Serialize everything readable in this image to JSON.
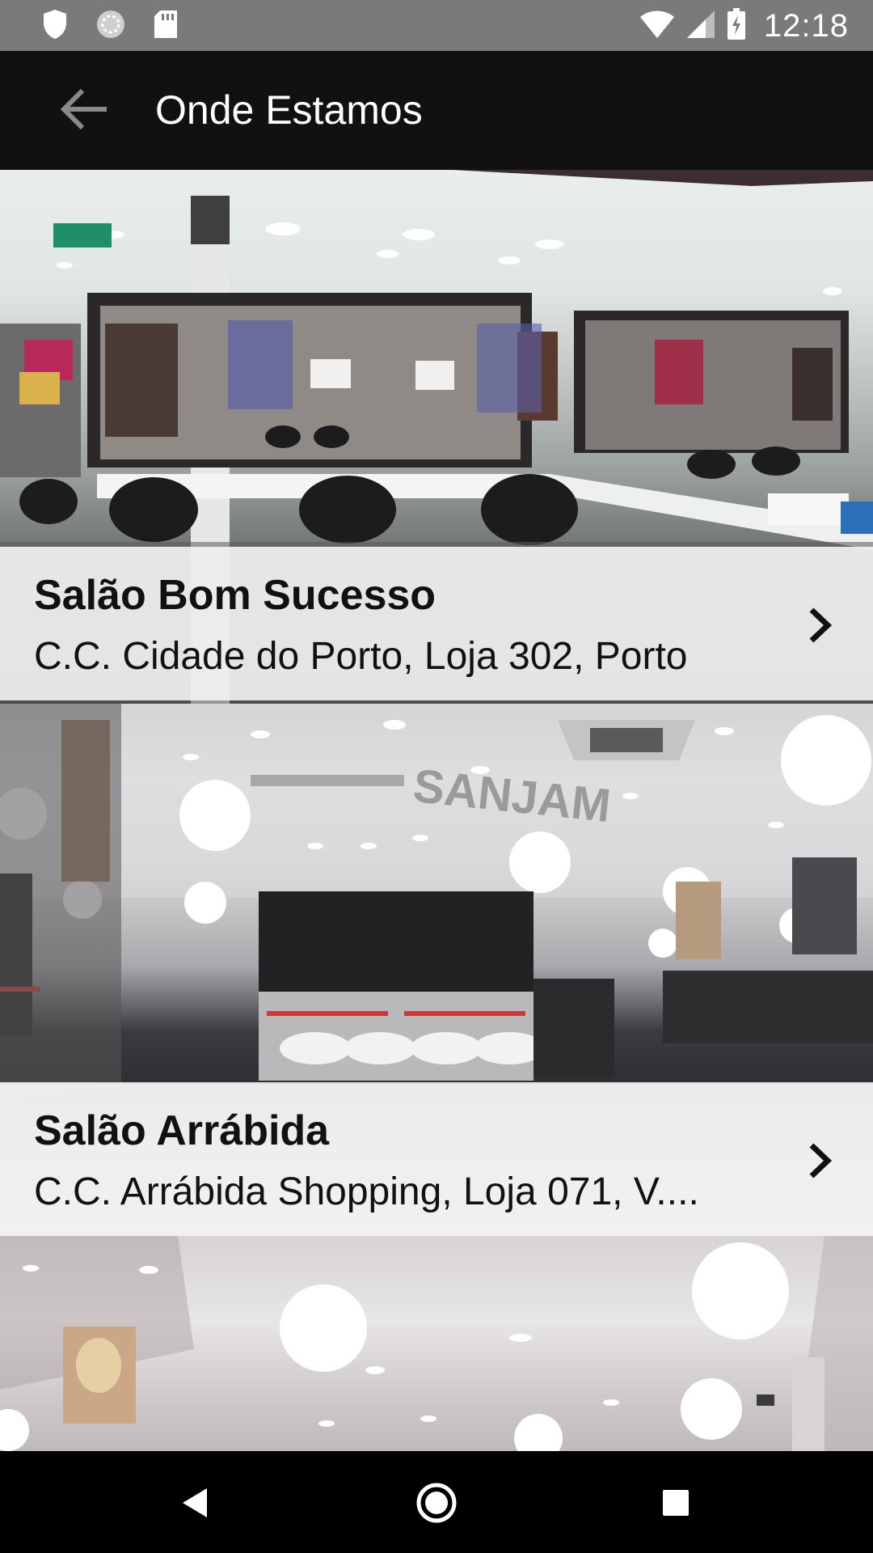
{
  "status_bar": {
    "time": "12:18",
    "icons": [
      "shield-icon",
      "sync-icon",
      "sd-card-icon",
      "wifi-icon",
      "signal-icon",
      "battery-charging-icon"
    ]
  },
  "toolbar": {
    "back_icon": "arrow-back-icon",
    "title": "Onde Estamos"
  },
  "salons": [
    {
      "name": "Salão Bom Sucesso",
      "address": "C.C. Cidade do Porto, Loja 302, Porto",
      "chevron_icon": "chevron-right-icon"
    },
    {
      "name": "Salão Arrábida",
      "address": "C.C. Arrábida Shopping, Loja 071, V....",
      "chevron_icon": "chevron-right-icon"
    }
  ],
  "nav_bar": {
    "icons": [
      "back-nav-icon",
      "home-nav-icon",
      "recents-nav-icon"
    ]
  },
  "colors": {
    "toolbar_bg": "#111111",
    "status_bar_bg": "#7a7a7a",
    "overlay_bg": "#f5f5f5"
  }
}
